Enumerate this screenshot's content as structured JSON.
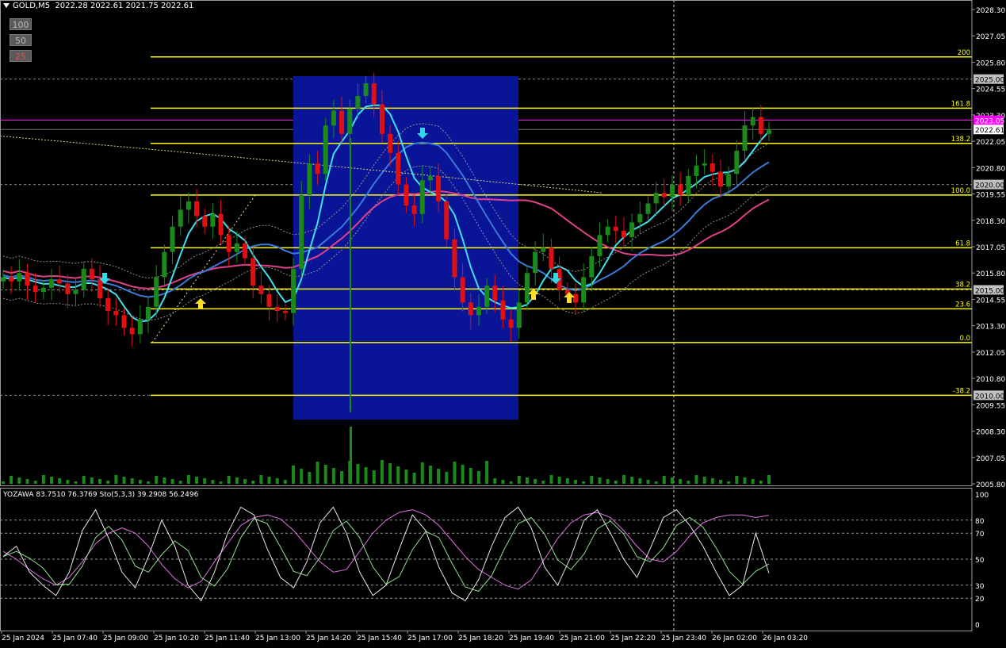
{
  "header": {
    "symbol": "GOLD,M5",
    "ohlc": "2022.28 2022.61 2021.75 2022.61"
  },
  "zoom_buttons": [
    "100",
    "50",
    "25"
  ],
  "price_axis": {
    "labels": [
      "2028.30",
      "2027.05",
      "2025.80",
      "2024.55",
      "2023.30",
      "2022.05",
      "2020.80",
      "2019.55",
      "2018.30",
      "2017.05",
      "2015.80",
      "2014.55",
      "2013.30",
      "2012.05",
      "2010.80",
      "2009.55",
      "2008.30",
      "2007.05",
      "2005.80"
    ],
    "boxed": [
      {
        "label": "2025.00",
        "bg": "#c0c0c0",
        "fg": "#000000"
      },
      {
        "label": "2023.05",
        "bg": "#ff00ff",
        "fg": "#ffffff"
      },
      {
        "label": "2022.61",
        "bg": "#ffffff",
        "fg": "#000000"
      },
      {
        "label": "2020.00",
        "bg": "#c0c0c0",
        "fg": "#000000"
      },
      {
        "label": "2015.00",
        "bg": "#c0c0c0",
        "fg": "#000000"
      },
      {
        "label": "2010.00",
        "bg": "#c0c0c0",
        "fg": "#000000"
      }
    ]
  },
  "fib_levels": [
    "200",
    "161.8",
    "138.2",
    "100.0",
    "61.8",
    "38.2",
    "23.6",
    "0.0",
    "-38.2"
  ],
  "time_axis": [
    "25 Jan 2024",
    "25 Jan 07:40",
    "25 Jan 09:00",
    "25 Jan 10:20",
    "25 Jan 11:40",
    "25 Jan 13:00",
    "25 Jan 14:20",
    "25 Jan 15:40",
    "25 Jan 17:00",
    "25 Jan 18:20",
    "25 Jan 19:40",
    "25 Jan 21:00",
    "25 Jan 22:20",
    "25 Jan 23:40",
    "26 Jan 02:00",
    "26 Jan 03:20"
  ],
  "indicator": {
    "title": "YOZAWA 83.7510 76.3769  Sto(5,3,3) 39.2908 56.2496",
    "levels": [
      "100",
      "80",
      "70",
      "50",
      "30",
      "20",
      "0"
    ]
  },
  "colors": {
    "background": "#000000",
    "bull": "#1a8a1a",
    "bear": "#e01010",
    "fib": "#ffff00",
    "zone": "#0a1496",
    "cyan_ma": "#40e0f0",
    "blue_ma": "#3a7ad8",
    "pink_ma": "#e0408a",
    "current_line": "#ff00ff"
  },
  "chart_data": [
    {
      "type": "candlestick",
      "title": "GOLD,M5",
      "price_range": [
        2005.8,
        2028.3
      ],
      "fib_prices": {
        "200": 2026.05,
        "161.8": 2023.62,
        "138.2": 2021.95,
        "100.0": 2019.5,
        "61.8": 2017.0,
        "38.2": 2015.04,
        "23.6": 2014.1,
        "0.0": 2012.5,
        "-38.2": 2010.0
      },
      "close_approx": [
        2015.6,
        2015.4,
        2015.8,
        2015.2,
        2014.9,
        2015.1,
        2015.5,
        2015.3,
        2014.8,
        2015.0,
        2016.0,
        2015.5,
        2014.6,
        2014.0,
        2013.8,
        2013.2,
        2012.9,
        2013.6,
        2014.2,
        2015.6,
        2016.8,
        2018.0,
        2018.8,
        2019.2,
        2018.5,
        2018.0,
        2018.6,
        2017.6,
        2016.8,
        2017.2,
        2016.5,
        2015.2,
        2014.8,
        2014.2,
        2014.0,
        2013.9,
        2016.0,
        2019.5,
        2021.0,
        2020.5,
        2022.8,
        2023.5,
        2022.4,
        2023.6,
        2024.2,
        2024.8,
        2023.8,
        2022.4,
        2021.5,
        2020.0,
        2019.0,
        2018.6,
        2020.2,
        2020.4,
        2019.2,
        2017.4,
        2015.6,
        2014.4,
        2013.8,
        2014.2,
        2015.2,
        2014.5,
        2013.6,
        2013.2,
        2014.4,
        2015.8,
        2016.8,
        2017.0,
        2016.0,
        2015.0,
        2014.8,
        2014.4,
        2015.6,
        2016.6,
        2017.6,
        2018.0,
        2017.8,
        2017.5,
        2018.2,
        2018.6,
        2019.1,
        2019.6,
        2019.4,
        2020.0,
        2019.5,
        2020.4,
        2020.9,
        2021.0,
        2020.6,
        2019.9,
        2020.5,
        2021.6,
        2022.8,
        2023.2,
        2022.4,
        2022.61
      ]
    },
    {
      "type": "line",
      "title": "YOZAWA / Sto(5,3,3)",
      "y_range": [
        0,
        100
      ],
      "series": [
        {
          "name": "YOZAWA",
          "values": [
            56,
            50,
            42,
            35,
            30,
            36,
            48,
            62,
            70,
            74,
            70,
            60,
            46,
            35,
            28,
            33,
            48,
            62,
            76,
            82,
            84,
            81,
            72,
            60,
            48,
            40,
            42,
            56,
            70,
            80,
            86,
            88,
            84,
            76,
            64,
            52,
            42,
            36,
            30,
            27,
            34,
            50,
            66,
            78,
            84,
            86,
            82,
            72,
            60,
            50,
            48,
            56,
            68,
            78,
            82,
            84,
            84,
            82,
            83.75
          ]
        },
        {
          "name": "Sto(5,3,3)",
          "values": [
            52,
            60,
            40,
            30,
            22,
            40,
            72,
            88,
            66,
            40,
            28,
            52,
            80,
            60,
            30,
            18,
            40,
            70,
            90,
            84,
            58,
            36,
            28,
            48,
            78,
            90,
            70,
            40,
            22,
            30,
            58,
            84,
            72,
            44,
            24,
            18,
            34,
            60,
            82,
            90,
            74,
            44,
            30,
            52,
            80,
            88,
            70,
            50,
            36,
            58,
            82,
            88,
            76,
            60,
            40,
            22,
            30,
            70,
            39.29
          ]
        }
      ]
    }
  ]
}
